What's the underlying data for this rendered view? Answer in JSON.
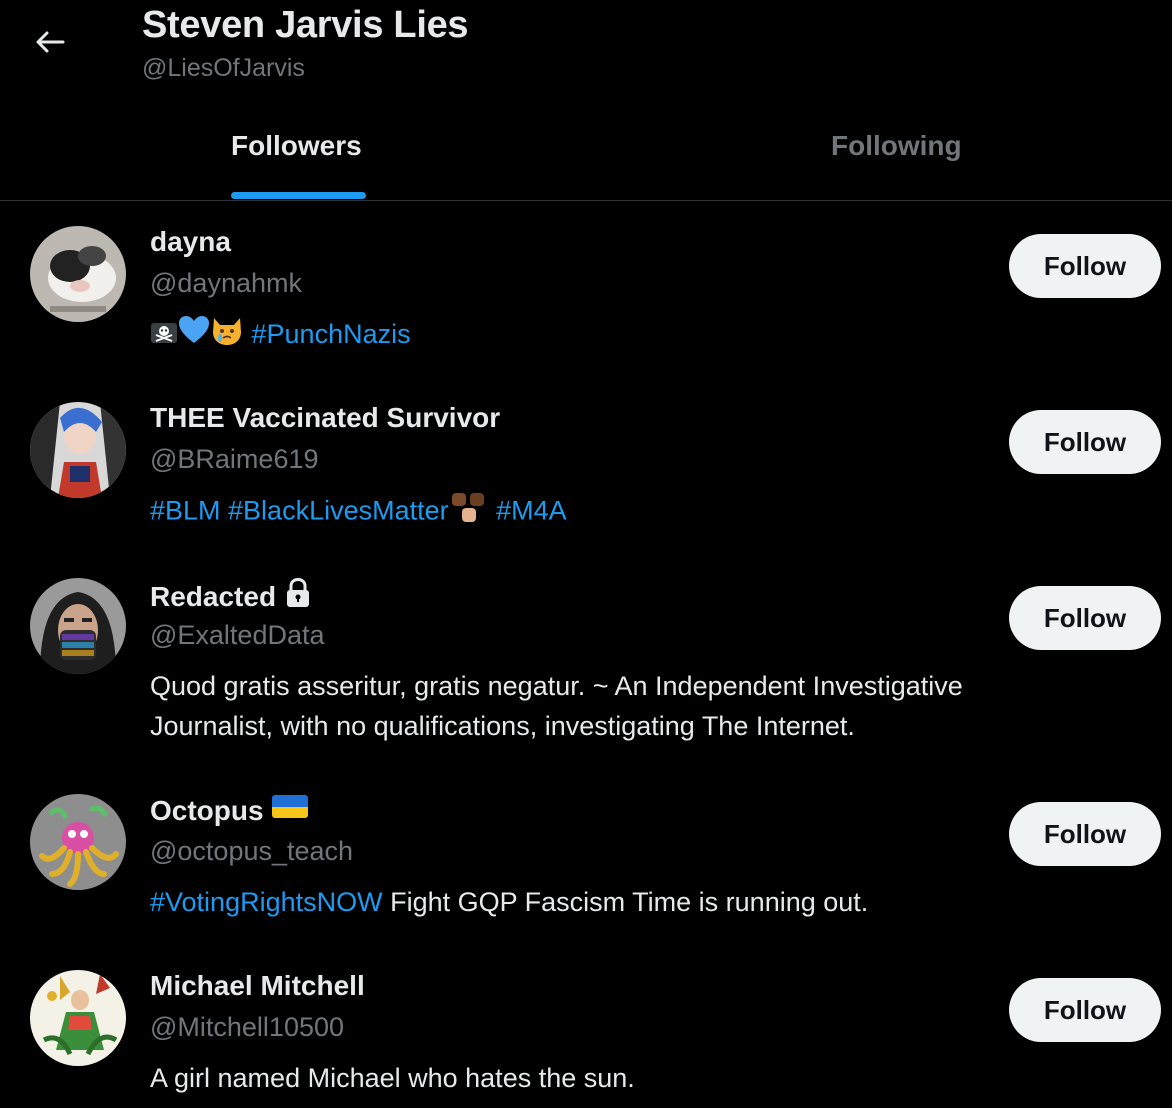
{
  "header": {
    "title": "Steven Jarvis Lies",
    "handle": "@LiesOfJarvis",
    "back_icon": "arrow-left-icon"
  },
  "tabs": [
    {
      "label": "Followers",
      "active": true
    },
    {
      "label": "Following",
      "active": false
    }
  ],
  "colors": {
    "accent": "#1d9bf0",
    "background": "#000000",
    "muted": "#71767b",
    "button": "#eff3f4"
  },
  "users": [
    {
      "name": "dayna",
      "handle": "@daynahmk",
      "bio": [
        {
          "type": "emoji",
          "icons": [
            "skull-crossbones-icon",
            "blue-heart-icon",
            "crying-cat-icon"
          ]
        },
        {
          "type": "tag",
          "text": "#PunchNazis"
        }
      ],
      "follow_label": "Follow"
    },
    {
      "name": "THEE Vaccinated Survivor",
      "handle": "@BRaime619",
      "bio": [
        {
          "type": "tag",
          "text": "#BLM #BlackLivesMatter"
        },
        {
          "type": "emoji",
          "icons": [
            "raised-fists-icon"
          ]
        },
        {
          "type": "tag",
          "text": " #M4A"
        }
      ],
      "follow_label": "Follow"
    },
    {
      "name": "Redacted",
      "handle": "@ExaltedData",
      "name_icon": "lock-icon",
      "bio": [
        {
          "type": "text",
          "text": "Quod gratis asseritur, gratis negatur. ~ An Independent Investigative Journalist, with no qualifications, investigating The Internet."
        }
      ],
      "follow_label": "Follow"
    },
    {
      "name": "Octopus",
      "handle": "@octopus_teach",
      "name_icon": "ukraine-flag-icon",
      "bio": [
        {
          "type": "tag",
          "text": "#VotingRightsNOW"
        },
        {
          "type": "text",
          "text": " Fight GQP Fascism Time is running out."
        }
      ],
      "follow_label": "Follow"
    },
    {
      "name": "Michael Mitchell",
      "handle": "@Mitchell10500",
      "bio": [
        {
          "type": "text",
          "text": "A girl named Michael who hates the sun."
        }
      ],
      "follow_label": "Follow"
    }
  ]
}
